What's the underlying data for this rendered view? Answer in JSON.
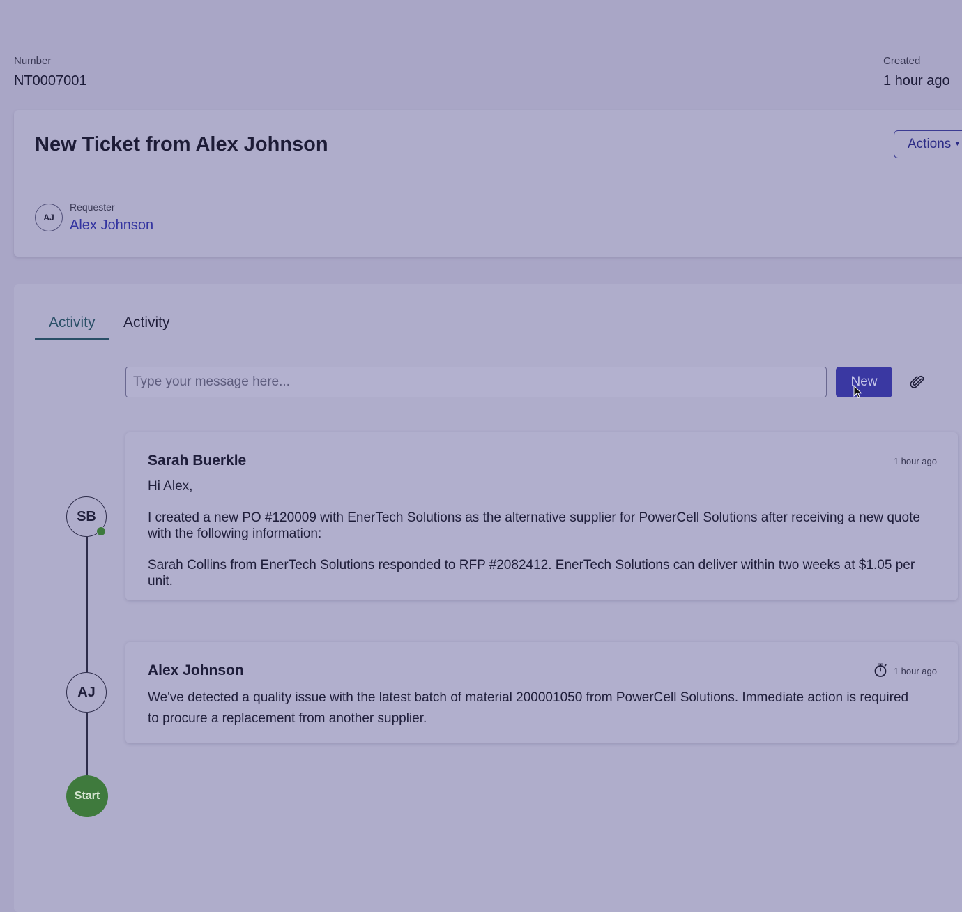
{
  "header": {
    "number_label": "Number",
    "number_value": "NT0007001",
    "created_label": "Created",
    "created_value": "1 hour ago"
  },
  "ticket": {
    "title": "New Ticket from Alex Johnson",
    "actions_label": "Actions",
    "requester_label": "Requester",
    "requester_initials": "AJ",
    "requester_name": "Alex Johnson"
  },
  "activity": {
    "tabs": [
      {
        "label": "Activity",
        "selected": true
      },
      {
        "label": "Activity",
        "selected": false
      }
    ],
    "input_placeholder": "Type your message here...",
    "new_button_label": "New",
    "messages": [
      {
        "initials": "SB",
        "author": "Sarah Buerkle",
        "time": "1 hour ago",
        "paragraphs": [
          "Hi Alex,",
          "I created a new PO #120009 with EnerTech Solutions as the alternative supplier for PowerCell Solutions after receiving a new quote with the following information:",
          "Sarah Collins from EnerTech Solutions responded to RFP #2082412. EnerTech Solutions can deliver within two weeks at $1.05 per unit."
        ]
      },
      {
        "initials": "AJ",
        "author": "Alex Johnson",
        "time": "1 hour ago",
        "paragraphs": [
          "We've detected a quality issue with the latest batch of material 200001050 from PowerCell Solutions. Immediate action is required to procure a replacement from another supplier."
        ]
      }
    ],
    "start_label": "Start"
  },
  "icons": {
    "attach": "paperclip-icon",
    "timer": "stopwatch-icon",
    "caret": "caret-down-icon",
    "cursor": "mouse-pointer-icon"
  },
  "colors": {
    "primary": "#3a38a2",
    "link": "#3334a0",
    "tab_active": "#2a4f67",
    "online": "#3d7a3d",
    "start": "#3f7a3d",
    "overlay_bg": "#a9a6c6"
  }
}
